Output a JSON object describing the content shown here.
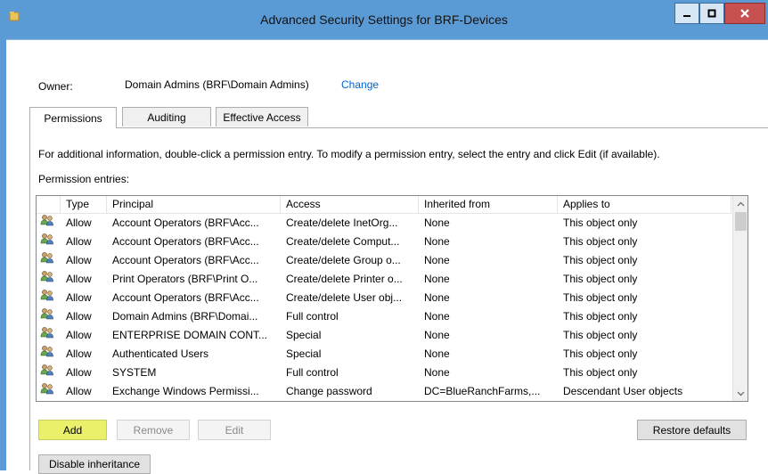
{
  "window": {
    "title": "Advanced Security Settings for BRF-Devices",
    "accent_color": "#5b9bd5",
    "controls": {
      "minimize": "minimize-icon",
      "maximize": "maximize-icon",
      "close": "close-icon"
    }
  },
  "owner": {
    "label": "Owner:",
    "value": "Domain Admins (BRF\\Domain Admins)",
    "change_link": "Change"
  },
  "tabs": [
    {
      "label": "Permissions",
      "selected": true
    },
    {
      "label": "Auditing",
      "selected": false
    },
    {
      "label": "Effective Access",
      "selected": false
    }
  ],
  "info_text": "For additional information, double-click a permission entry. To modify a permission entry, select the entry and click Edit (if available).",
  "entries_label": "Permission entries:",
  "table": {
    "columns": [
      "Type",
      "Principal",
      "Access",
      "Inherited from",
      "Applies to"
    ],
    "rows": [
      {
        "type": "Allow",
        "principal": "Account Operators (BRF\\Acc...",
        "access": "Create/delete InetOrg...",
        "inherited": "None",
        "applies": "This object only"
      },
      {
        "type": "Allow",
        "principal": "Account Operators (BRF\\Acc...",
        "access": "Create/delete Comput...",
        "inherited": "None",
        "applies": "This object only"
      },
      {
        "type": "Allow",
        "principal": "Account Operators (BRF\\Acc...",
        "access": "Create/delete Group o...",
        "inherited": "None",
        "applies": "This object only"
      },
      {
        "type": "Allow",
        "principal": "Print Operators (BRF\\Print O...",
        "access": "Create/delete Printer o...",
        "inherited": "None",
        "applies": "This object only"
      },
      {
        "type": "Allow",
        "principal": "Account Operators (BRF\\Acc...",
        "access": "Create/delete User obj...",
        "inherited": "None",
        "applies": "This object only"
      },
      {
        "type": "Allow",
        "principal": "Domain Admins (BRF\\Domai...",
        "access": "Full control",
        "inherited": "None",
        "applies": "This object only"
      },
      {
        "type": "Allow",
        "principal": "ENTERPRISE DOMAIN CONT...",
        "access": "Special",
        "inherited": "None",
        "applies": "This object only"
      },
      {
        "type": "Allow",
        "principal": "Authenticated Users",
        "access": "Special",
        "inherited": "None",
        "applies": "This object only"
      },
      {
        "type": "Allow",
        "principal": "SYSTEM",
        "access": "Full control",
        "inherited": "None",
        "applies": "This object only"
      },
      {
        "type": "Allow",
        "principal": "Exchange Windows Permissi...",
        "access": "Change password",
        "inherited": "DC=BlueRanchFarms,...",
        "applies": "Descendant User objects"
      }
    ]
  },
  "buttons": {
    "add": "Add",
    "remove": "Remove",
    "edit": "Edit",
    "restore_defaults": "Restore defaults",
    "disable_inheritance": "Disable inheritance"
  },
  "colors": {
    "highlight": "#eaf06a",
    "link": "#0066cc"
  }
}
